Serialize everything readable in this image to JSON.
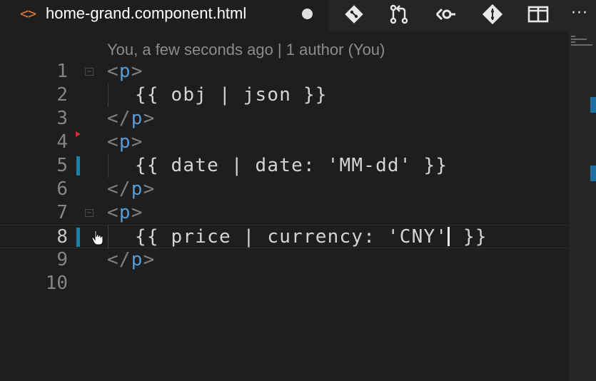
{
  "tab": {
    "icon": "html-file-icon",
    "glyph": "<>",
    "title": "home-grand.component.html",
    "dirty": true
  },
  "toolbar": {
    "icons": [
      "git-compare-icon",
      "pull-request-icon",
      "open-changes-icon",
      "git-branch-icon",
      "split-editor-icon",
      "more-actions-icon"
    ],
    "more_label": "···"
  },
  "editor": {
    "codelens": "You, a few seconds ago | 1 author (You)",
    "current_line": 8,
    "lines": [
      {
        "number": "1",
        "segments": [
          {
            "t": "<",
            "c": "punct"
          },
          {
            "t": "p",
            "c": "tag"
          },
          {
            "t": ">",
            "c": "punct"
          }
        ]
      },
      {
        "number": "2",
        "segments": [
          {
            "t": "{{ obj | json }}",
            "c": "text"
          }
        ]
      },
      {
        "number": "3",
        "segments": [
          {
            "t": "</",
            "c": "punct"
          },
          {
            "t": "p",
            "c": "tag"
          },
          {
            "t": ">",
            "c": "punct"
          }
        ]
      },
      {
        "number": "4",
        "segments": [
          {
            "t": "<",
            "c": "punct"
          },
          {
            "t": "p",
            "c": "tag"
          },
          {
            "t": ">",
            "c": "punct"
          }
        ]
      },
      {
        "number": "5",
        "segments": [
          {
            "t": "{{ date | date: 'MM-dd' }}",
            "c": "text"
          }
        ]
      },
      {
        "number": "6",
        "segments": [
          {
            "t": "</",
            "c": "punct"
          },
          {
            "t": "p",
            "c": "tag"
          },
          {
            "t": ">",
            "c": "punct"
          }
        ]
      },
      {
        "number": "7",
        "segments": [
          {
            "t": "<",
            "c": "punct"
          },
          {
            "t": "p",
            "c": "tag"
          },
          {
            "t": ">",
            "c": "punct"
          }
        ]
      },
      {
        "number": "8",
        "segments": [
          {
            "t": "{{ price | currency: 'CNY'",
            "c": "text"
          },
          {
            "t": " }}",
            "c": "text"
          }
        ]
      },
      {
        "number": "9",
        "segments": [
          {
            "t": "</",
            "c": "punct"
          },
          {
            "t": "p",
            "c": "tag"
          },
          {
            "t": ">",
            "c": "punct"
          }
        ]
      },
      {
        "number": "10",
        "segments": []
      }
    ]
  },
  "colors": {
    "background": "#1e1e1e",
    "tab_icon": "#e37933",
    "tag": "#569cd6",
    "git_modified": "#1b81a8",
    "breakpoint_hint": "#d9282e"
  }
}
